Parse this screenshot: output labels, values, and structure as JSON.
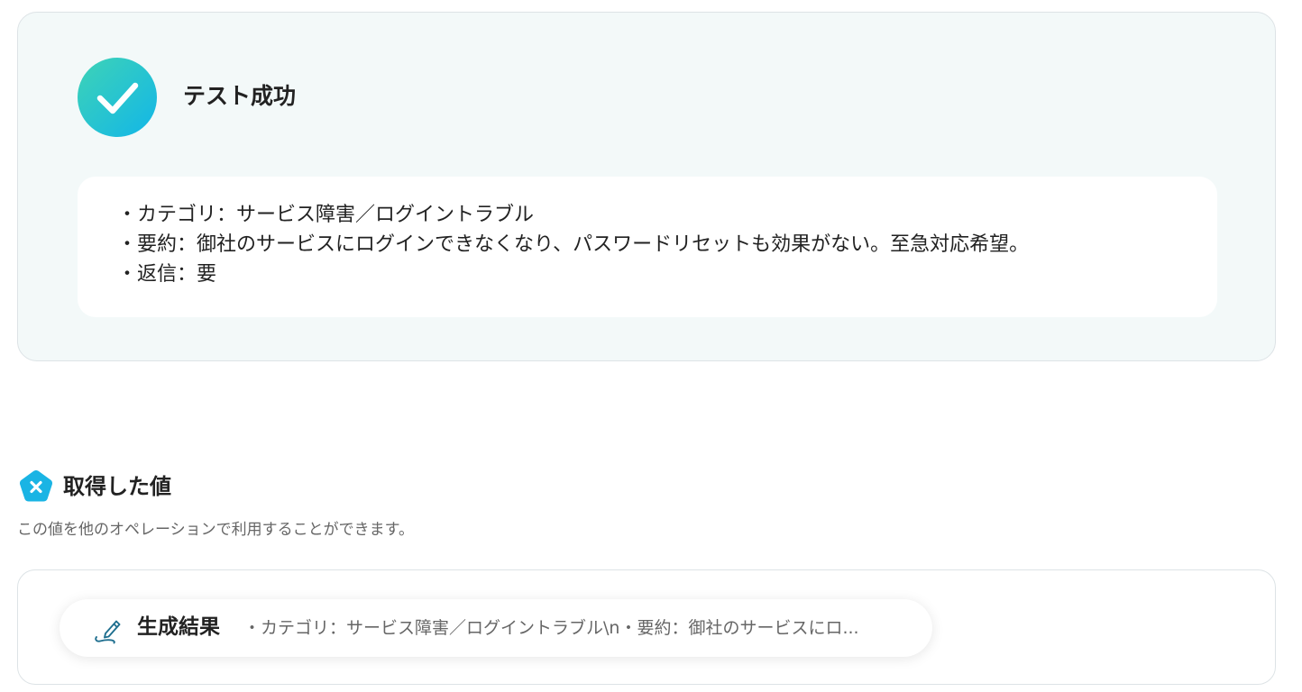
{
  "test_result": {
    "status_icon": "check-icon",
    "title": "テスト成功",
    "lines": [
      "・カテゴリ：サービス障害／ログイントラブル",
      "・要約：御社のサービスにログインできなくなり、パスワードリセットも効果がない。至急対応希望。",
      "・返信：要"
    ]
  },
  "obtained_values": {
    "icon": "pentagon-x-icon",
    "title": "取得した値",
    "description": "この値を他のオペレーションで利用することができます。",
    "items": [
      {
        "icon": "pen-icon",
        "label": "生成結果",
        "value": "・カテゴリ：サービス障害／ログイントラブル\\n・要約：御社のサービスにロ..."
      }
    ]
  },
  "colors": {
    "success_gradient_start": "#3ed3b6",
    "success_gradient_end": "#12b6e8",
    "panel_background": "#f3f9f9",
    "badge_color": "#1ab4e4",
    "pen_icon_color": "#1f6f8f"
  }
}
